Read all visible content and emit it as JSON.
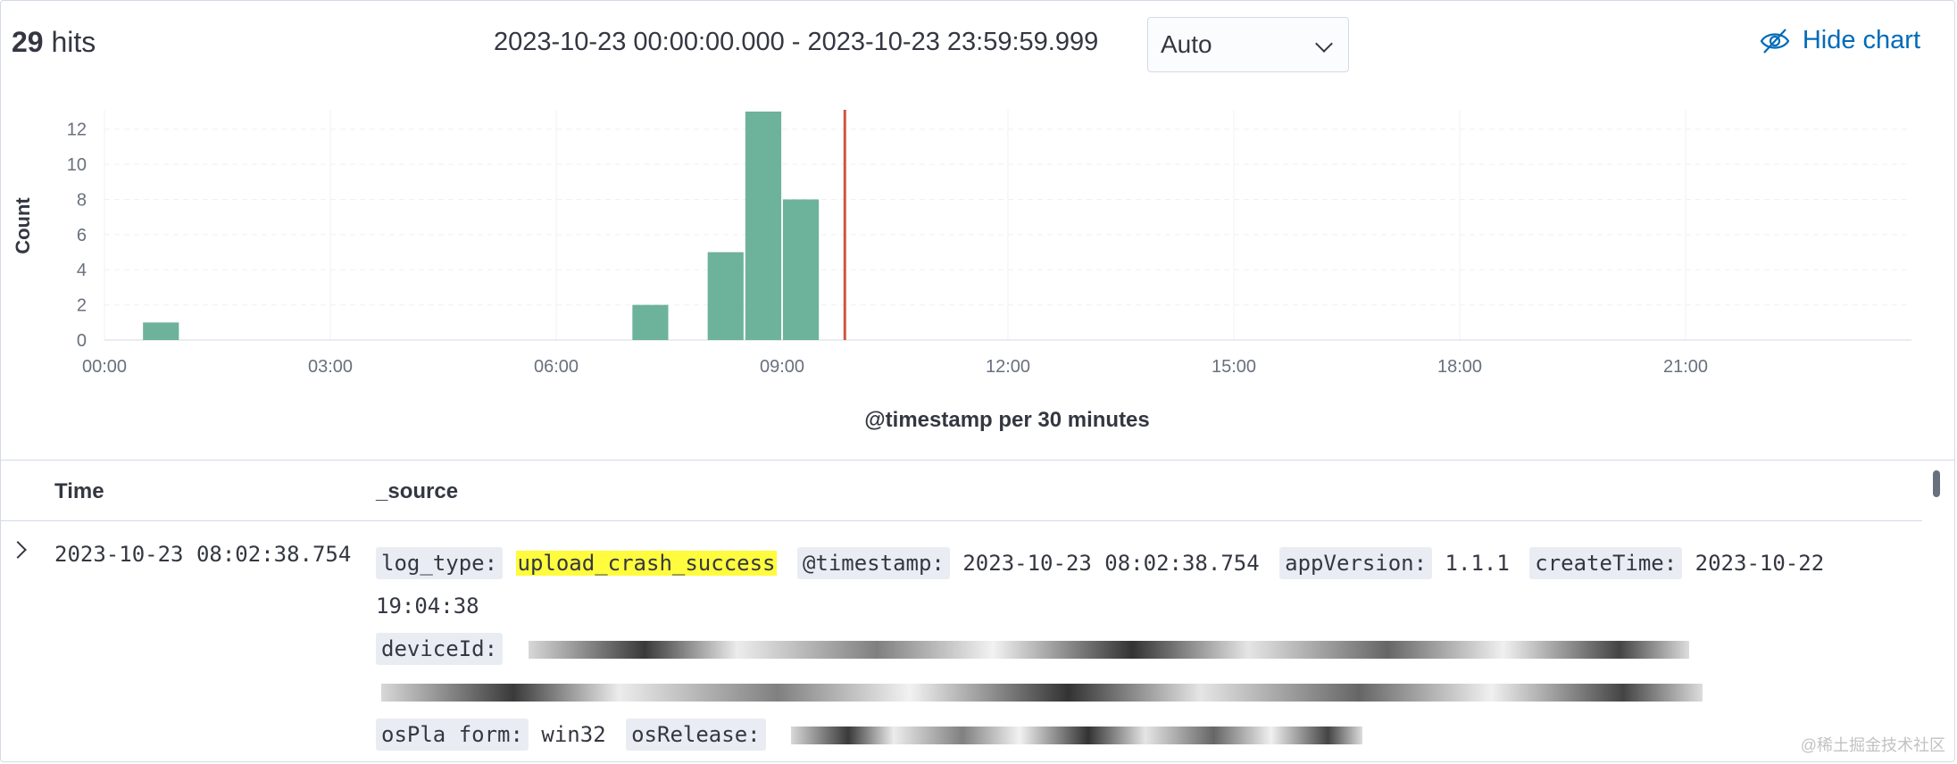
{
  "header": {
    "hits_count": "29",
    "hits_label": "hits",
    "time_range": "2023-10-23 00:00:00.000 - 2023-10-23 23:59:59.999",
    "interval": "Auto",
    "hide_chart_label": "Hide chart"
  },
  "chart_data": {
    "type": "bar",
    "ylabel": "Count",
    "xlabel": "@timestamp per 30 minutes",
    "ylim": [
      0,
      13
    ],
    "yticks": [
      "0",
      "2",
      "4",
      "6",
      "8",
      "10",
      "12"
    ],
    "xticks": [
      "00:00",
      "03:00",
      "06:00",
      "09:00",
      "12:00",
      "15:00",
      "18:00",
      "21:00"
    ],
    "bars": [
      {
        "start": "00:30",
        "value": 1
      },
      {
        "start": "07:00",
        "value": 2
      },
      {
        "start": "08:00",
        "value": 5
      },
      {
        "start": "08:30",
        "value": 13
      },
      {
        "start": "09:00",
        "value": 8
      }
    ],
    "now_marker": "09:50",
    "bar_color": "#6db29a",
    "marker_color": "#cc5642",
    "grid": true
  },
  "table": {
    "columns": [
      "Time",
      "_source"
    ],
    "rows": [
      {
        "time": "2023-10-23 08:02:38.754",
        "log_type_key": "log_type:",
        "log_type_val": "upload_crash_success",
        "timestamp_key": "@timestamp:",
        "timestamp_val": "2023-10-23 08:02:38.754",
        "appversion_key": "appVersion:",
        "appversion_val": "1.1.1",
        "createtime_key": "createTime:",
        "createtime_val": "2023-10-22 19:04:38",
        "deviceid_key": "deviceId:",
        "osplatform_key": "osPla form:",
        "osplatform_val": "win32",
        "osrelease_key": "osRelease:"
      }
    ]
  },
  "watermark": "@稀土掘金技术社区"
}
